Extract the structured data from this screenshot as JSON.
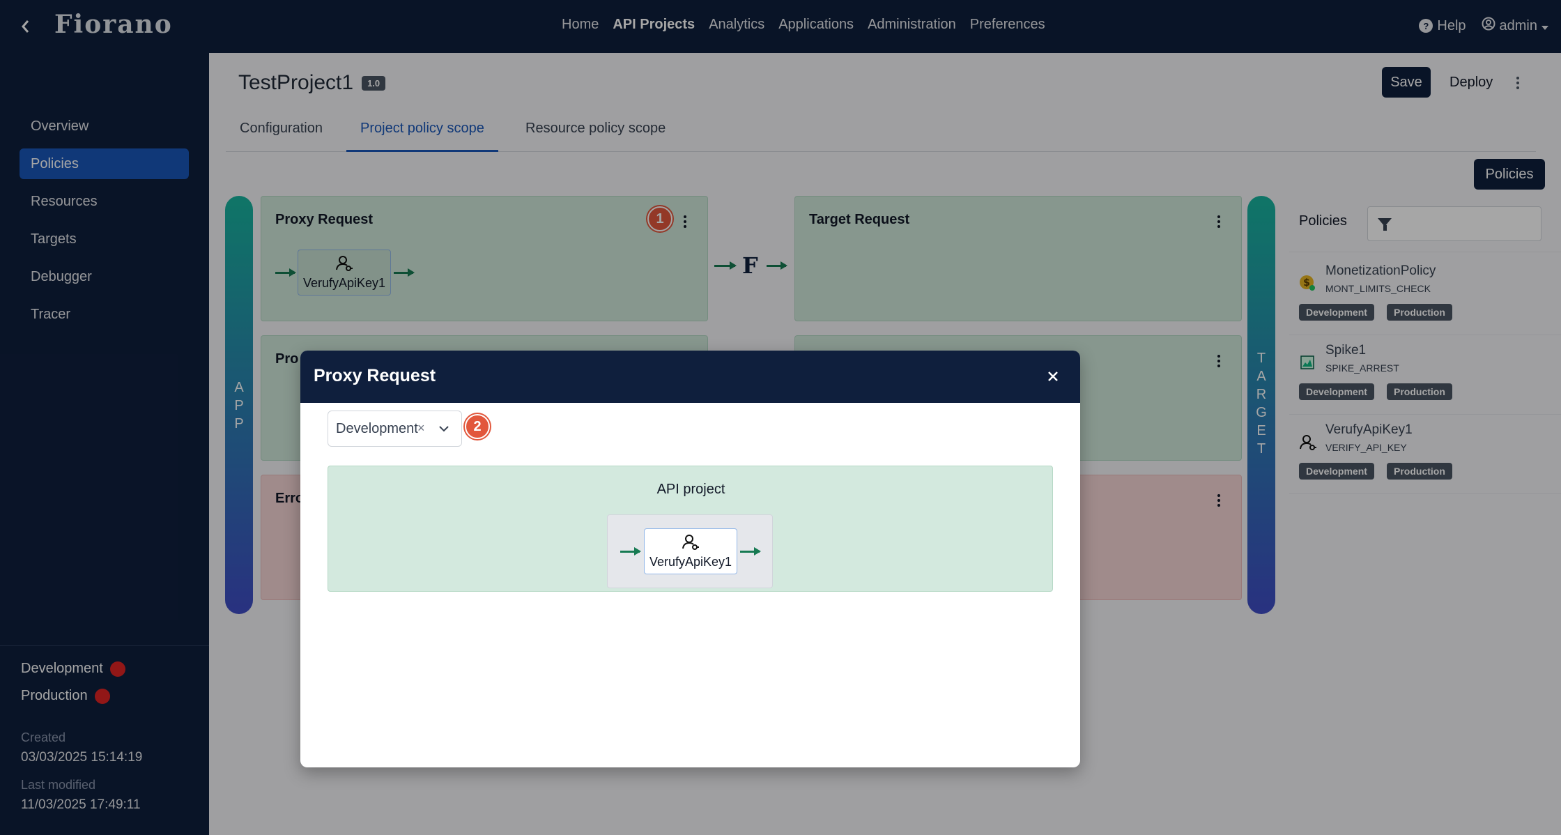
{
  "app": {
    "logo": "Fiorano"
  },
  "topnav": {
    "items": [
      "Home",
      "API Projects",
      "Analytics",
      "Applications",
      "Administration",
      "Preferences"
    ],
    "active": "API Projects"
  },
  "topright": {
    "help": "Help",
    "user": "admin"
  },
  "sidebar": {
    "items": [
      {
        "label": "Overview"
      },
      {
        "label": "Policies"
      },
      {
        "label": "Resources"
      },
      {
        "label": "Targets"
      },
      {
        "label": "Debugger"
      },
      {
        "label": "Tracer"
      }
    ],
    "active": "Policies",
    "environments": [
      {
        "label": "Development",
        "status_color": "#e02424"
      },
      {
        "label": "Production",
        "status_color": "#e02424"
      }
    ],
    "created_label": "Created",
    "created_value": "03/03/2025 15:14:19",
    "modified_label": "Last modified",
    "modified_value": "11/03/2025 17:49:11"
  },
  "project": {
    "name": "TestProject1",
    "version": "1.0"
  },
  "actions": {
    "save": "Save",
    "deploy": "Deploy",
    "policies": "Policies"
  },
  "tabs": [
    {
      "label": "Configuration"
    },
    {
      "label": "Project policy scope"
    },
    {
      "label": "Resource policy scope"
    }
  ],
  "active_tab": "Project policy scope",
  "canvas": {
    "app_bar": "APP",
    "target_bar": "TARGET",
    "proxy_request": {
      "title": "Proxy Request",
      "policy": "VerufyApiKey1",
      "badge": "1"
    },
    "target_request": {
      "title": "Target Request"
    },
    "proxy_response_partial": "Pro",
    "error_partial": "Erro"
  },
  "policies_panel": {
    "title": "Policies",
    "items": [
      {
        "name": "MonetizationPolicy",
        "type": "MONT_LIMITS_CHECK",
        "icon": "coin-icon",
        "tags": [
          "Development",
          "Production"
        ]
      },
      {
        "name": "Spike1",
        "type": "SPIKE_ARREST",
        "icon": "chart-icon",
        "tags": [
          "Development",
          "Production"
        ]
      },
      {
        "name": "VerufyApiKey1",
        "type": "VERIFY_API_KEY",
        "icon": "user-key-icon",
        "tags": [
          "Development",
          "Production"
        ]
      }
    ]
  },
  "modal": {
    "title": "Proxy Request",
    "env_select": "Development",
    "badge": "2",
    "area_title": "API project",
    "policy": "VerufyApiKey1"
  },
  "colors": {
    "navy": "#0f1f3d",
    "accent": "#1a56b8",
    "flow_green": "#167a52",
    "badge": "#e2573c"
  }
}
